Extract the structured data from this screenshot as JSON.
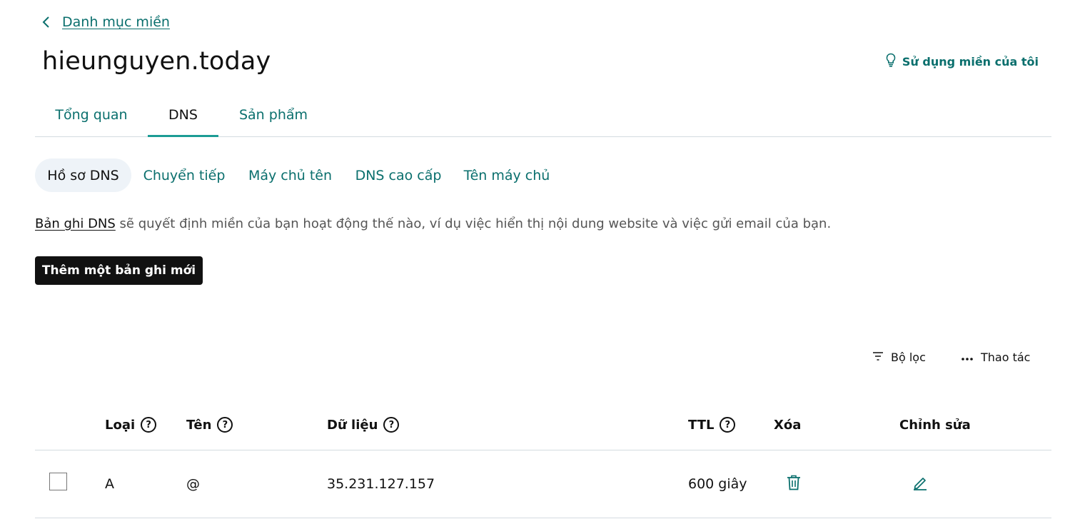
{
  "breadcrumb": {
    "label": "Danh mục miền",
    "icon": "chevron-left-icon"
  },
  "page": {
    "title": "hieunguyen.today"
  },
  "header_action": {
    "label": "Sử dụng miền của tôi",
    "icon": "lightbulb-icon"
  },
  "main_tabs": [
    {
      "label": "Tổng quan",
      "active": false
    },
    {
      "label": "DNS",
      "active": true
    },
    {
      "label": "Sản phẩm",
      "active": false
    }
  ],
  "sub_tabs": [
    {
      "label": "Hồ sơ DNS",
      "active": true
    },
    {
      "label": "Chuyển tiếp",
      "active": false
    },
    {
      "label": "Máy chủ tên",
      "active": false
    },
    {
      "label": "DNS cao cấp",
      "active": false
    },
    {
      "label": "Tên máy chủ",
      "active": false
    }
  ],
  "description": {
    "link": "Bản ghi DNS",
    "text": " sẽ quyết định miền của bạn hoạt động thế nào, ví dụ việc hiển thị nội dung website và việc gửi email của bạn."
  },
  "add_button": {
    "label": "Thêm một bản ghi mới"
  },
  "toolbar": {
    "filter": {
      "label": "Bộ lọc",
      "icon": "filter-icon"
    },
    "actions": {
      "label": "Thao tác",
      "icon": "more-horizontal-icon"
    }
  },
  "table": {
    "help_glyph": "?",
    "columns": {
      "type": "Loại",
      "name": "Tên",
      "data": "Dữ liệu",
      "ttl": "TTL",
      "delete": "Xóa",
      "edit": "Chỉnh sửa"
    },
    "rows": [
      {
        "type": "A",
        "name": "@",
        "data": "35.231.127.157",
        "ttl": "600 giây",
        "checked": false
      }
    ]
  },
  "colors": {
    "accent": "#0a6f6d",
    "tab_underline": "#1c9c95",
    "primary_button": "#111111",
    "pill_bg": "#eef3f8",
    "divider": "#d4dbe0"
  }
}
